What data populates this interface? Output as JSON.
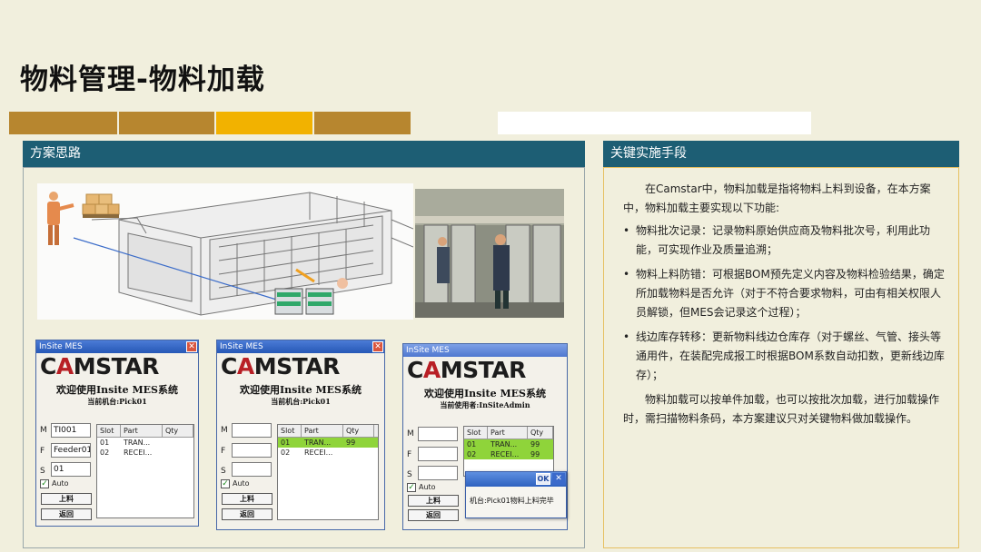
{
  "title": "物料管理-物料加载",
  "colors": {
    "bar1": "#b7862f",
    "bar2": "#b7862f",
    "bar3": "#f2b200",
    "bar4": "#b7862f",
    "bar5": "#ffffff",
    "panel_head": "#1d5e74",
    "right_border": "#e6c062"
  },
  "left_panel": {
    "heading": "方案思路"
  },
  "right_panel": {
    "heading": "关键实施手段",
    "intro": "在Camstar中，物料加载是指将物料上料到设备，在本方案中，物料加载主要实现以下功能:",
    "bullets": [
      "物料批次记录：记录物料原始供应商及物料批次号，利用此功能，可实现作业及质量追溯；",
      "物料上料防错：可根据BOM预先定义内容及物料检验结果，确定所加载物料是否允许（对于不符合要求物料，可由有相关权限人员解锁，但MES会记录这个过程）；",
      "线边库存转移：更新物料线边仓库存（对于螺丝、气管、接头等通用件，在装配完成报工时根据BOM系数自动扣数，更新线边库存）；"
    ],
    "outro": "物料加载可以按单件加载，也可以按批次加载，进行加载操作时，需扫描物料条码，本方案建议只对关键物料做加载操作。"
  },
  "mes_windows": [
    {
      "title": "InSite MES",
      "logo": "CAMSTAR",
      "welcome": "欢迎使用Insite MES系统",
      "current": "当前机台:Pick01",
      "labels": {
        "m": "M",
        "f": "F",
        "s": "S"
      },
      "fields": {
        "m": "TI001",
        "f": "Feeder01",
        "s": "01"
      },
      "auto_label": "Auto",
      "load_button": "上料",
      "back_button": "返回",
      "columns": [
        "Slot",
        "Part",
        "Qty"
      ],
      "rows": [
        {
          "slot": "01",
          "part": "TRAN...",
          "qty": "",
          "selected": false
        },
        {
          "slot": "02",
          "part": "RECEI...",
          "qty": "",
          "selected": false
        }
      ]
    },
    {
      "title": "InSite MES",
      "logo": "CAMSTAR",
      "welcome": "欢迎使用Insite MES系统",
      "current": "当前机台:Pick01",
      "labels": {
        "m": "M",
        "f": "F",
        "s": "S"
      },
      "fields": {
        "m": "",
        "f": "",
        "s": ""
      },
      "auto_label": "Auto",
      "load_button": "上料",
      "back_button": "返回",
      "columns": [
        "Slot",
        "Part",
        "Qty"
      ],
      "rows": [
        {
          "slot": "01",
          "part": "TRAN...",
          "qty": "99",
          "selected": true
        },
        {
          "slot": "02",
          "part": "RECEI...",
          "qty": "",
          "selected": false
        }
      ]
    },
    {
      "title": "InSite MES",
      "logo": "CAMSTAR",
      "welcome": "欢迎使用Insite MES系统",
      "current": "当前使用者:InSiteAdmin",
      "labels": {
        "m": "M",
        "f": "F",
        "s": "S"
      },
      "fields": {
        "m": "",
        "f": "",
        "s": ""
      },
      "auto_label": "Auto",
      "load_button": "上料",
      "back_button": "返回",
      "columns": [
        "Slot",
        "Part",
        "Qty"
      ],
      "rows": [
        {
          "slot": "01",
          "part": "TRAN...",
          "qty": "99",
          "selected": true
        },
        {
          "slot": "02",
          "part": "RECEI...",
          "qty": "99",
          "selected": true
        }
      ],
      "popup": {
        "ok": "OK",
        "message": "机台:Pick01物料上料完毕"
      }
    }
  ]
}
